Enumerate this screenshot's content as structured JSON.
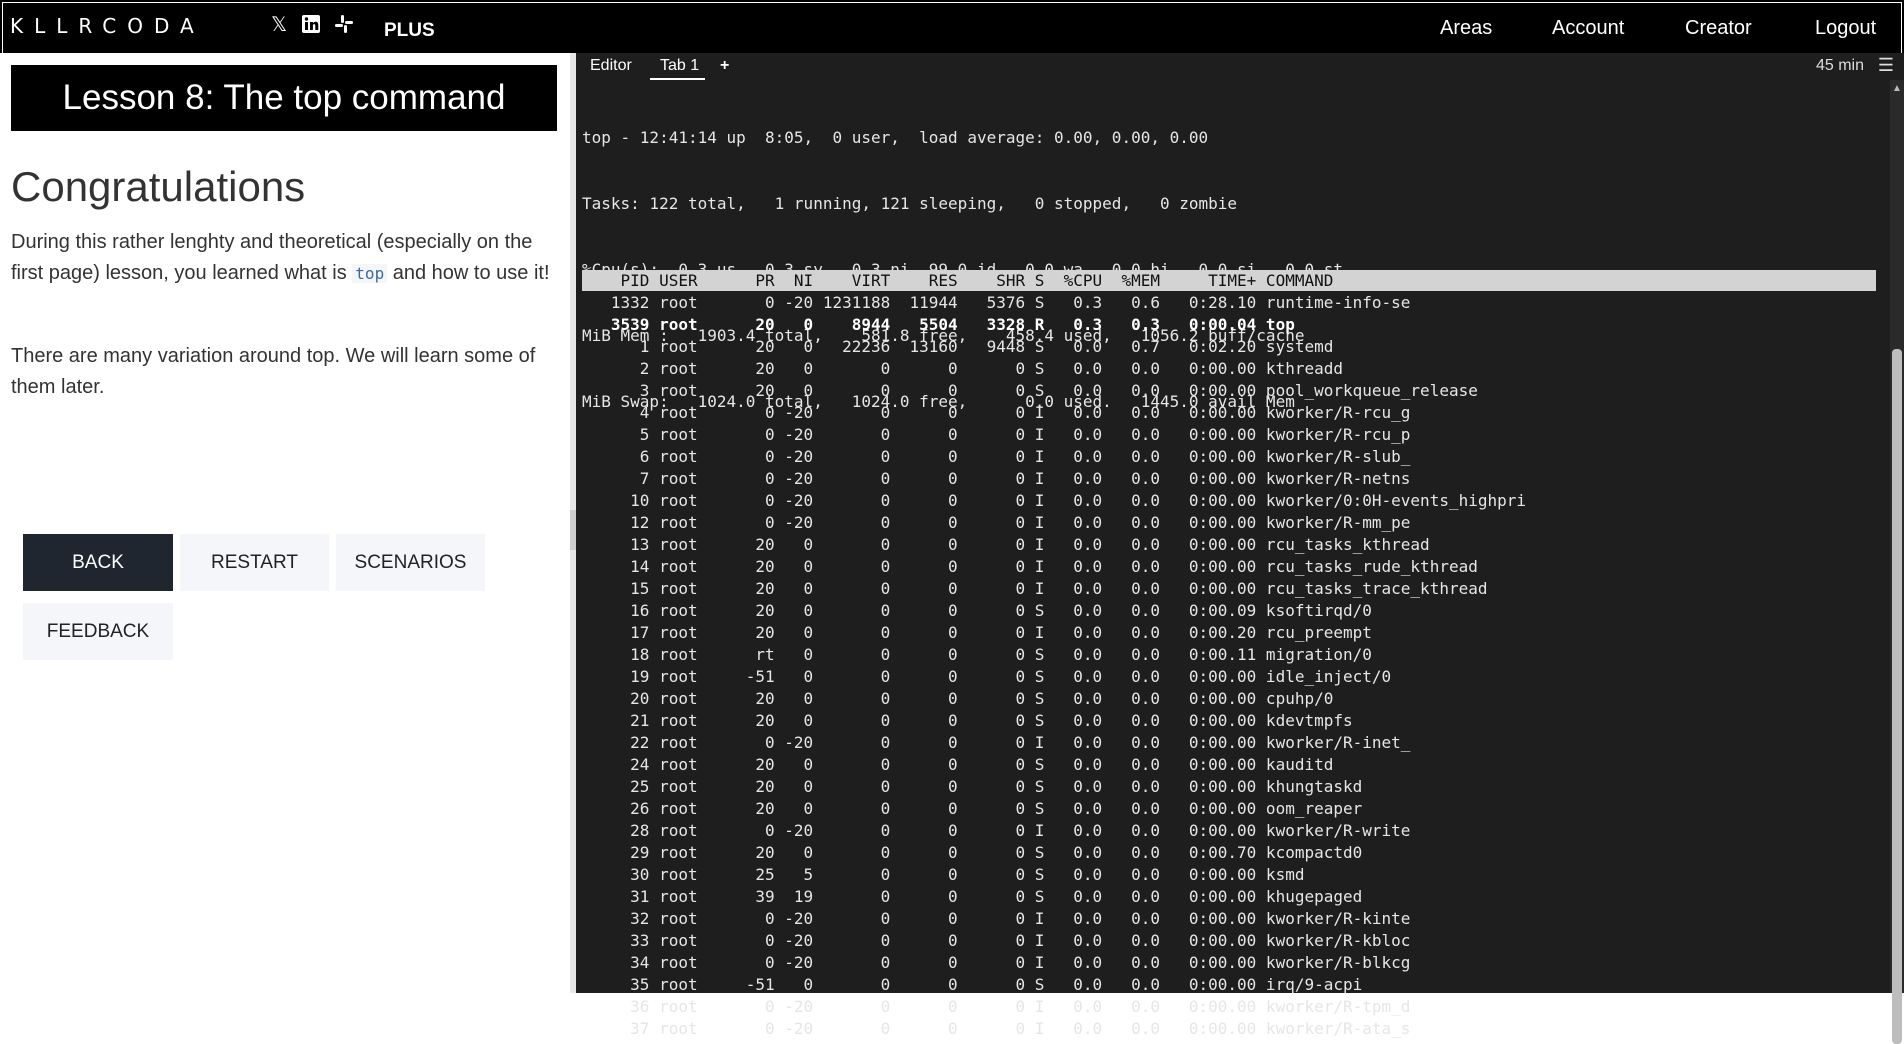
{
  "nav": {
    "logo": "KLLRCODA",
    "social": [
      "x-icon",
      "linkedin-icon",
      "slack-icon"
    ],
    "plus": "PLUS",
    "links": [
      "Areas",
      "Account",
      "Creator",
      "Logout"
    ]
  },
  "lesson": {
    "title": "Lesson 8: The top command",
    "heading": "Congratulations",
    "para1_a": "During this rather lenghty and theoretical (especially on the first page) lesson, you learned what is ",
    "para1_code": "top",
    "para1_b": " and how to use it!",
    "para2": "There are many variation around top. We will learn some of them later."
  },
  "buttons": {
    "back": "BACK",
    "restart": "RESTART",
    "scenarios": "SCENARIOS",
    "feedback": "FEEDBACK"
  },
  "terminal": {
    "tab_editor": "Editor",
    "tab_1": "Tab 1",
    "add_tab": "+",
    "time_left": "45 min",
    "summary": [
      "top - 12:41:14 up  8:05,  0 user,  load average: 0.00, 0.00, 0.00",
      "Tasks: 122 total,   1 running, 121 sleeping,   0 stopped,   0 zombie",
      "%Cpu(s):  0.3 us,  0.3 sy,  0.3 ni, 99.0 id,  0.0 wa,  0.0 hi,  0.0 si,  0.0 st",
      "MiB Mem :   1903.4 total,    581.8 free,    458.4 used,   1056.2 buff/cache",
      "MiB Swap:   1024.0 total,   1024.0 free,      0.0 used.   1445.0 avail Mem"
    ],
    "header": "    PID USER      PR  NI    VIRT    RES    SHR S  %CPU  %MEM     TIME+ COMMAND",
    "rows": [
      "   1332 root       0 -20 1231188  11944   5376 S   0.3   0.6   0:28.10 runtime-info-se",
      "   3539 root      20   0    8944   5504   3328 R   0.3   0.3   0:00.04 top",
      "      1 root      20   0   22236  13160   9448 S   0.0   0.7   0:02.20 systemd",
      "      2 root      20   0       0      0      0 S   0.0   0.0   0:00.00 kthreadd",
      "      3 root      20   0       0      0      0 S   0.0   0.0   0:00.00 pool_workqueue_release",
      "      4 root       0 -20       0      0      0 I   0.0   0.0   0:00.00 kworker/R-rcu_g",
      "      5 root       0 -20       0      0      0 I   0.0   0.0   0:00.00 kworker/R-rcu_p",
      "      6 root       0 -20       0      0      0 I   0.0   0.0   0:00.00 kworker/R-slub_",
      "      7 root       0 -20       0      0      0 I   0.0   0.0   0:00.00 kworker/R-netns",
      "     10 root       0 -20       0      0      0 I   0.0   0.0   0:00.00 kworker/0:0H-events_highpri",
      "     12 root       0 -20       0      0      0 I   0.0   0.0   0:00.00 kworker/R-mm_pe",
      "     13 root      20   0       0      0      0 I   0.0   0.0   0:00.00 rcu_tasks_kthread",
      "     14 root      20   0       0      0      0 I   0.0   0.0   0:00.00 rcu_tasks_rude_kthread",
      "     15 root      20   0       0      0      0 I   0.0   0.0   0:00.00 rcu_tasks_trace_kthread",
      "     16 root      20   0       0      0      0 S   0.0   0.0   0:00.09 ksoftirqd/0",
      "     17 root      20   0       0      0      0 I   0.0   0.0   0:00.20 rcu_preempt",
      "     18 root      rt   0       0      0      0 S   0.0   0.0   0:00.11 migration/0",
      "     19 root     -51   0       0      0      0 S   0.0   0.0   0:00.00 idle_inject/0",
      "     20 root      20   0       0      0      0 S   0.0   0.0   0:00.00 cpuhp/0",
      "     21 root      20   0       0      0      0 S   0.0   0.0   0:00.00 kdevtmpfs",
      "     22 root       0 -20       0      0      0 I   0.0   0.0   0:00.00 kworker/R-inet_",
      "     24 root      20   0       0      0      0 S   0.0   0.0   0:00.00 kauditd",
      "     25 root      20   0       0      0      0 S   0.0   0.0   0:00.00 khungtaskd",
      "     26 root      20   0       0      0      0 S   0.0   0.0   0:00.00 oom_reaper",
      "     28 root       0 -20       0      0      0 I   0.0   0.0   0:00.00 kworker/R-write",
      "     29 root      20   0       0      0      0 S   0.0   0.0   0:00.70 kcompactd0",
      "     30 root      25   5       0      0      0 S   0.0   0.0   0:00.00 ksmd",
      "     31 root      39  19       0      0      0 S   0.0   0.0   0:00.00 khugepaged",
      "     32 root       0 -20       0      0      0 I   0.0   0.0   0:00.00 kworker/R-kinte",
      "     33 root       0 -20       0      0      0 I   0.0   0.0   0:00.00 kworker/R-kbloc",
      "     34 root       0 -20       0      0      0 I   0.0   0.0   0:00.00 kworker/R-blkcg",
      "     35 root     -51   0       0      0      0 S   0.0   0.0   0:00.00 irq/9-acpi",
      "     36 root       0 -20       0      0      0 I   0.0   0.0   0:00.00 kworker/R-tpm_d",
      "     37 root       0 -20       0      0      0 I   0.0   0.0   0:00.00 kworker/R-ata_s"
    ],
    "bold_row_index": 1
  }
}
